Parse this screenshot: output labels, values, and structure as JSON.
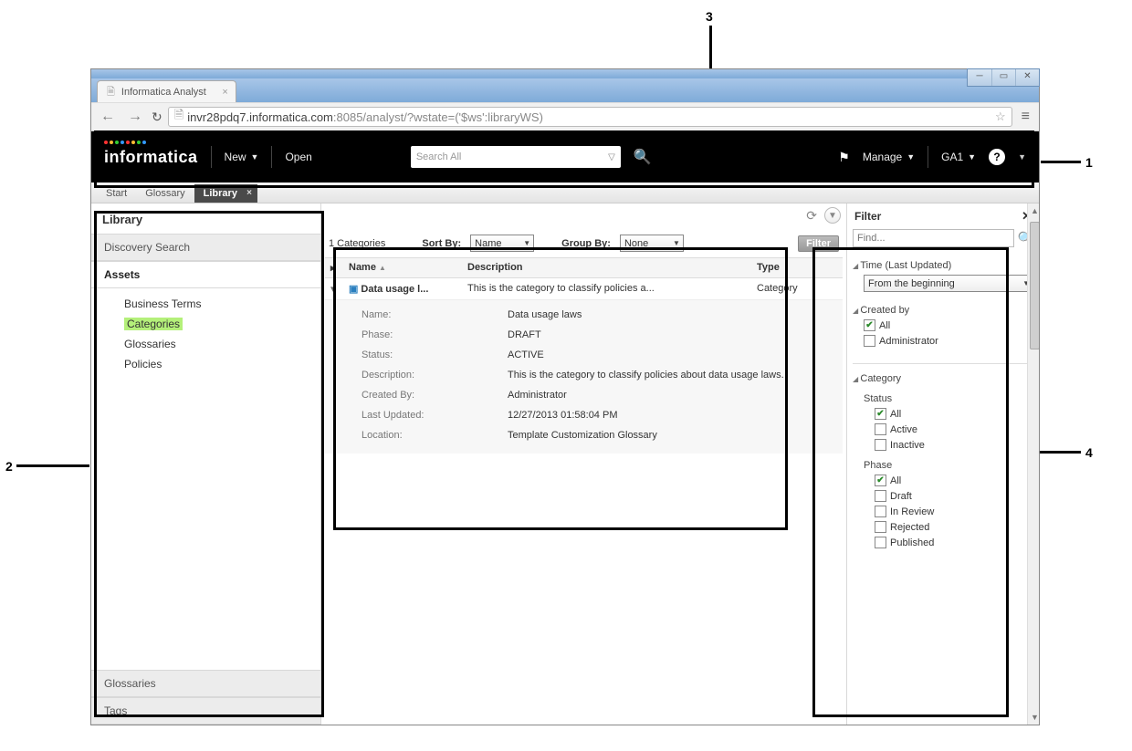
{
  "browser": {
    "tab_title": "Informatica Analyst",
    "url_host": "invr28pdq7.informatica.com",
    "url_rest": ":8085/analyst/?wstate=('$ws':libraryWS)"
  },
  "topbar": {
    "logo": "informatica",
    "new": "New",
    "open": "Open",
    "search_placeholder": "Search All",
    "manage": "Manage",
    "user": "GA1"
  },
  "subtabs": {
    "start": "Start",
    "glossary": "Glossary",
    "library": "Library"
  },
  "left": {
    "title": "Library",
    "discovery": "Discovery Search",
    "assets": "Assets",
    "glossaries": "Glossaries",
    "tags": "Tags",
    "items": [
      "Business Terms",
      "Categories",
      "Glossaries",
      "Policies"
    ]
  },
  "center": {
    "count_label": "1 Categories",
    "sort_label": "Sort By:",
    "sort_value": "Name",
    "group_label": "Group By:",
    "group_value": "None",
    "filter_btn": "Filter",
    "cols": {
      "name": "Name",
      "desc": "Description",
      "type": "Type"
    },
    "row": {
      "name": "Data usage l...",
      "desc": "This is the category to classify policies a...",
      "type": "Category"
    },
    "details": {
      "name_l": "Name:",
      "name_v": "Data usage laws",
      "phase_l": "Phase:",
      "phase_v": "DRAFT",
      "status_l": "Status:",
      "status_v": "ACTIVE",
      "desc_l": "Description:",
      "desc_v": "This is the category to classify policies about data usage laws.",
      "created_l": "Created By:",
      "created_v": "Administrator",
      "updated_l": "Last Updated:",
      "updated_v": "12/27/2013 01:58:04 PM",
      "loc_l": "Location:",
      "loc_v": "Template Customization Glossary"
    }
  },
  "filter": {
    "title": "Filter",
    "find_placeholder": "Find...",
    "time_title": "Time (Last Updated)",
    "time_value": "From the beginning",
    "createdby_title": "Created by",
    "createdby_opts": [
      "All",
      "Administrator"
    ],
    "category_title": "Category",
    "status_title": "Status",
    "status_opts": [
      "All",
      "Active",
      "Inactive"
    ],
    "phase_title": "Phase",
    "phase_opts": [
      "All",
      "Draft",
      "In Review",
      "Rejected",
      "Published"
    ]
  },
  "callouts": {
    "one": "1",
    "two": "2",
    "three": "3",
    "four": "4"
  }
}
